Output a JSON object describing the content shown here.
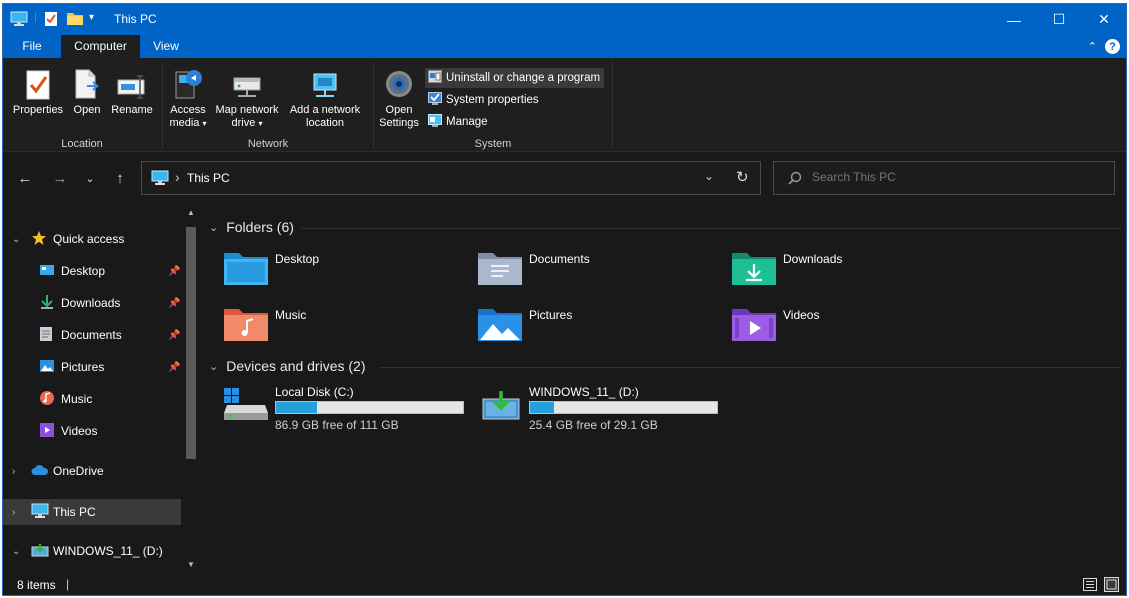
{
  "window": {
    "title": "This PC",
    "controls": {
      "minimize": "—",
      "maximize": "☐",
      "close": "✕"
    }
  },
  "ribbon": {
    "tabs": [
      {
        "label": "File"
      },
      {
        "label": "Computer"
      },
      {
        "label": "View"
      }
    ],
    "groups": {
      "location": {
        "label": "Location",
        "buttons": [
          {
            "label": "Properties"
          },
          {
            "label": "Open"
          },
          {
            "label": "Rename"
          }
        ]
      },
      "network": {
        "label": "Network",
        "access_media": "Access media",
        "access_media_l1": "Access",
        "access_media_l2": "media",
        "map_drive_l1": "Map network",
        "map_drive_l2": "drive",
        "add_location_l1": "Add a network",
        "add_location_l2": "location"
      },
      "system": {
        "label": "System",
        "open_settings_l1": "Open",
        "open_settings_l2": "Settings",
        "uninstall": "Uninstall or change a program",
        "system_properties": "System properties",
        "manage": "Manage"
      }
    }
  },
  "address": {
    "path": "This PC",
    "separator": "›"
  },
  "search": {
    "placeholder": "Search This PC"
  },
  "nav_pane": {
    "quick_access": "Quick access",
    "items": [
      {
        "label": "Desktop"
      },
      {
        "label": "Downloads"
      },
      {
        "label": "Documents"
      },
      {
        "label": "Pictures"
      },
      {
        "label": "Music"
      },
      {
        "label": "Videos"
      }
    ],
    "onedrive": "OneDrive",
    "this_pc": "This PC",
    "usb": "WINDOWS_11_ (D:)"
  },
  "content": {
    "folders_header": "Folders (6)",
    "folders": [
      {
        "label": "Desktop"
      },
      {
        "label": "Documents"
      },
      {
        "label": "Downloads"
      },
      {
        "label": "Music"
      },
      {
        "label": "Pictures"
      },
      {
        "label": "Videos"
      }
    ],
    "drives_header": "Devices and drives (2)",
    "drives": [
      {
        "label": "Local Disk (C:)",
        "free": "86.9 GB free of 111 GB",
        "used_fraction": 0.22
      },
      {
        "label": "WINDOWS_11_ (D:)",
        "free": "25.4 GB free of 29.1 GB",
        "used_fraction": 0.13
      }
    ]
  },
  "status": {
    "items": "8 items"
  },
  "colors": {
    "accent": "#0063c6",
    "drive_bar": "#26a0da"
  }
}
